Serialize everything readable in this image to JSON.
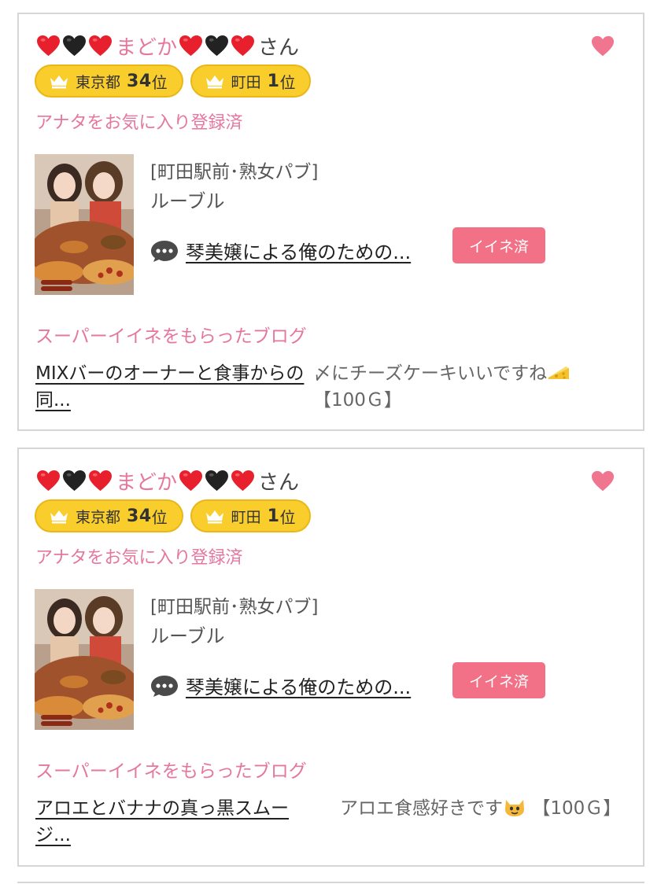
{
  "cards": [
    {
      "user": {
        "name": "まどか",
        "suffix": "さん"
      },
      "rank_pref": {
        "area": "東京都",
        "num": "34",
        "suffix": "位"
      },
      "rank_city": {
        "area": "町田",
        "num": "1",
        "suffix": "位"
      },
      "favorite_status": "アナタをお気に入り登録済",
      "shop_area": "[町田駅前･熟女パブ]",
      "shop_name": "ルーブル",
      "blog_title": "琴美嬢による俺のための...",
      "like_label": "イイネ済",
      "super_heading": "スーパーイイネをもらったブログ",
      "super_blog_title": "MIXバーのオーナーと食事からの同...",
      "super_comment": "〆にチーズケーキいいですね",
      "super_reward": "【100Ｇ】"
    },
    {
      "user": {
        "name": "まどか",
        "suffix": "さん"
      },
      "rank_pref": {
        "area": "東京都",
        "num": "34",
        "suffix": "位"
      },
      "rank_city": {
        "area": "町田",
        "num": "1",
        "suffix": "位"
      },
      "favorite_status": "アナタをお気に入り登録済",
      "shop_area": "[町田駅前･熟女パブ]",
      "shop_name": "ルーブル",
      "blog_title": "琴美嬢による俺のための...",
      "like_label": "イイネ済",
      "super_heading": "スーパーイイネをもらったブログ",
      "super_blog_title": "アロエとバナナの真っ黒スムージ...",
      "super_comment": "アロエ食感好きです",
      "super_reward": "【100Ｇ】"
    }
  ],
  "colors": {
    "accent_pink": "#e5779f",
    "like_button": "#f27186",
    "badge_yellow": "#f9cd2c",
    "heart_red": "#e8202e",
    "heart_black": "#222222",
    "favorite_heart": "#f0768f"
  },
  "icons": [
    "red-heart-icon",
    "black-heart-icon",
    "favorite-heart-icon",
    "crown-icon",
    "comment-icon",
    "cheese-icon",
    "cat-face-icon"
  ]
}
